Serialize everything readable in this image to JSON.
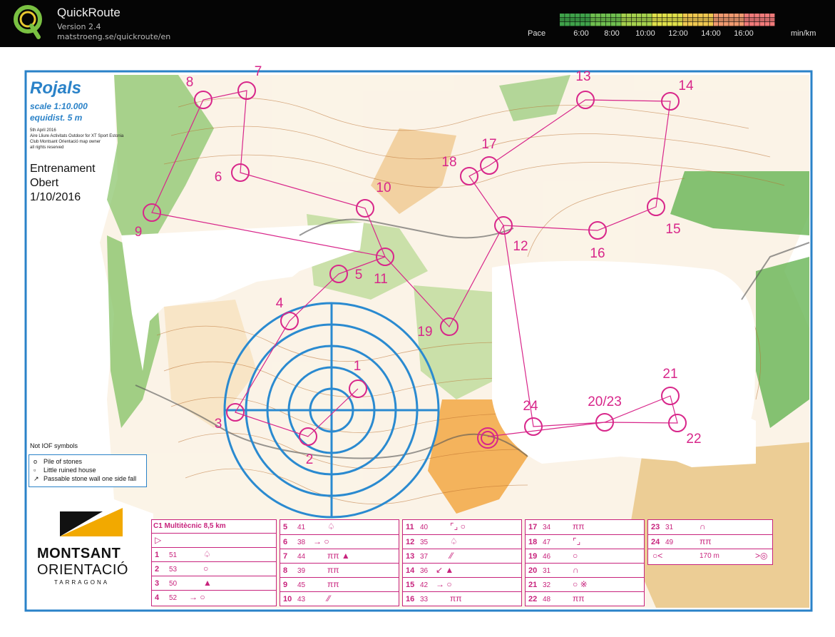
{
  "app": {
    "name": "QuickRoute",
    "version": "Version 2.4",
    "url": "matstroeng.se/quickroute/en"
  },
  "pace": {
    "label": "Pace",
    "ticks": [
      "6:00",
      "8:00",
      "10:00",
      "12:00",
      "14:00",
      "16:00"
    ],
    "unit": "min/km",
    "colors": [
      "#3fa24a",
      "#6fbf4f",
      "#a6d24d",
      "#e0e04a",
      "#f0c850",
      "#f09a70",
      "#f07a7a"
    ]
  },
  "map": {
    "title": "Rojals",
    "scale": "scale 1:10.000",
    "equidistance": "equidist. 5 m",
    "credits": [
      "5th April 2016",
      "Aire Lliure Activitats Outdoor for XT Sport Estonia",
      "Club Montsant Orientació map owner",
      "all rights reserved"
    ],
    "event": [
      "Entrenament",
      "Obert",
      "1/10/2016"
    ],
    "legend_title": "Not IOF symbols",
    "legend": [
      {
        "symbol": "o",
        "label": "Pile of stones"
      },
      {
        "symbol": "▫",
        "label": "Little ruined house"
      },
      {
        "symbol": "↗",
        "label": "Passable stone wall one side fall"
      }
    ],
    "org": {
      "name": "MONTSANT",
      "sub": "ORIENTACIÓ",
      "city": "TARRAGONA"
    },
    "controls": [
      "1",
      "2",
      "3",
      "4",
      "5",
      "6",
      "7",
      "8",
      "9",
      "10",
      "11",
      "12",
      "13",
      "14",
      "15",
      "16",
      "17",
      "18",
      "19",
      "20/23",
      "21",
      "22",
      "24"
    ]
  },
  "descriptions": {
    "header": "C1 Multitècnic  8,5 km",
    "col1": [
      {
        "n": "1",
        "code": "51",
        "sym": "♤"
      },
      {
        "n": "2",
        "code": "53",
        "sym": "○"
      },
      {
        "n": "3",
        "code": "50",
        "sym": "▲"
      },
      {
        "n": "4",
        "code": "52",
        "sym": "→ ○"
      }
    ],
    "col2": [
      {
        "n": "5",
        "code": "41",
        "sym": "♤"
      },
      {
        "n": "6",
        "code": "38",
        "sym": "→ ○"
      },
      {
        "n": "7",
        "code": "44",
        "sym": "ππ ▲"
      },
      {
        "n": "8",
        "code": "39",
        "sym": "ππ"
      },
      {
        "n": "9",
        "code": "45",
        "sym": "ππ"
      },
      {
        "n": "10",
        "code": "43",
        "sym": "⁄⁄"
      }
    ],
    "col3": [
      {
        "n": "11",
        "code": "40",
        "sym": "⌜⌟ ○"
      },
      {
        "n": "12",
        "code": "35",
        "sym": "♤"
      },
      {
        "n": "13",
        "code": "37",
        "sym": "⁄⁄"
      },
      {
        "n": "14",
        "code": "36",
        "sym": "↙ ▲"
      },
      {
        "n": "15",
        "code": "42",
        "sym": "→ ○"
      },
      {
        "n": "16",
        "code": "33",
        "sym": "ππ"
      }
    ],
    "col4": [
      {
        "n": "17",
        "code": "34",
        "sym": "ππ"
      },
      {
        "n": "18",
        "code": "47",
        "sym": "⌜⌟"
      },
      {
        "n": "19",
        "code": "46",
        "sym": "○"
      },
      {
        "n": "20",
        "code": "31",
        "sym": "∩"
      },
      {
        "n": "21",
        "code": "32",
        "sym": "○ ※"
      },
      {
        "n": "22",
        "code": "48",
        "sym": "ππ"
      }
    ],
    "col5": [
      {
        "n": "23",
        "code": "31",
        "sym": "∩"
      },
      {
        "n": "24",
        "code": "49",
        "sym": "ππ"
      }
    ],
    "finish_distance": "170 m"
  }
}
